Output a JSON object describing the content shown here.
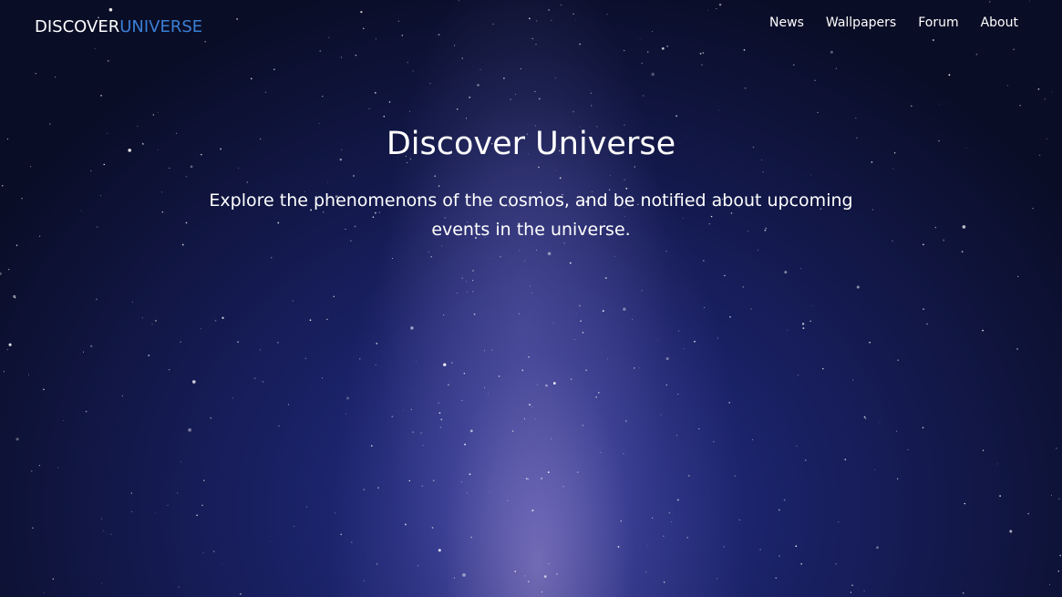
{
  "navbar": {
    "brand_first": "DISCOVER",
    "brand_second": "UNIVERSE",
    "links": [
      {
        "label": "News"
      },
      {
        "label": "Wallpapers"
      },
      {
        "label": "Forum"
      },
      {
        "label": "About"
      }
    ]
  },
  "hero": {
    "title": "Discover Universe",
    "subtitle": "Explore the phenomenons of the cosmos, and be notified about upcoming events in the universe."
  },
  "colors": {
    "brand_accent": "#3a7fd5",
    "text": "#ffffff",
    "sky_dark": "#0a0d26",
    "sky_mid": "#1a2165",
    "milky_way": "#aa96d7"
  }
}
